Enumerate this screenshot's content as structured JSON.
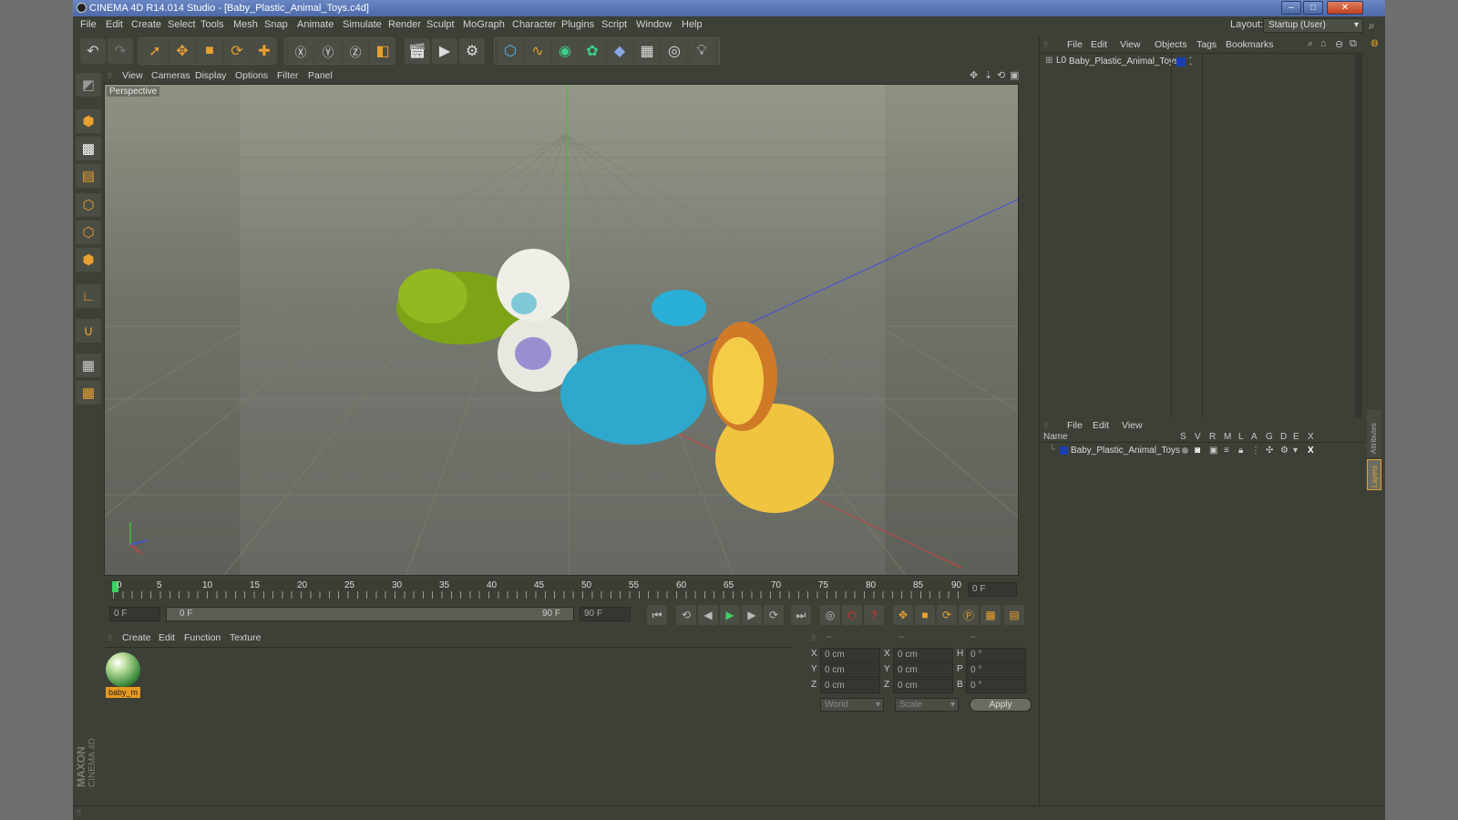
{
  "window": {
    "title": "CINEMA 4D R14.014 Studio - [Baby_Plastic_Animal_Toys.c4d]",
    "min": "–",
    "max": "□",
    "close": "✕"
  },
  "menu": [
    "File",
    "Edit",
    "Create",
    "Select",
    "Tools",
    "Mesh",
    "Snap",
    "Animate",
    "Simulate",
    "Render",
    "Sculpt",
    "MoGraph",
    "Character",
    "Plugins",
    "Script",
    "Window",
    "Help"
  ],
  "layout": {
    "label": "Layout:",
    "value": "Startup (User)"
  },
  "viewport": {
    "menu": [
      "View",
      "Cameras",
      "Display",
      "Options",
      "Filter",
      "Panel"
    ],
    "label": "Perspective"
  },
  "timeline": {
    "ticks": [
      "0",
      "5",
      "10",
      "15",
      "20",
      "25",
      "30",
      "35",
      "40",
      "45",
      "50",
      "55",
      "60",
      "65",
      "70",
      "75",
      "80",
      "85",
      "90"
    ],
    "current_frame": "0 F"
  },
  "transport": {
    "start_field": "0 F",
    "range_start": "0 F",
    "range_end": "90 F",
    "end_field": "90 F"
  },
  "material_manager": {
    "menu": [
      "Create",
      "Edit",
      "Function",
      "Texture"
    ],
    "materials": [
      {
        "label": "baby_m"
      }
    ]
  },
  "coordinates": {
    "header": [
      "--",
      "--",
      "--"
    ],
    "rows": [
      {
        "a": "X",
        "av": "0 cm",
        "b": "X",
        "bv": "0 cm",
        "c": "H",
        "cv": "0 °"
      },
      {
        "a": "Y",
        "av": "0 cm",
        "b": "Y",
        "bv": "0 cm",
        "c": "P",
        "cv": "0 °"
      },
      {
        "a": "Z",
        "av": "0 cm",
        "b": "Z",
        "bv": "0 cm",
        "c": "B",
        "cv": "0 °"
      }
    ],
    "mode1": "World",
    "mode2": "Scale",
    "apply": "Apply"
  },
  "object_manager": {
    "menu": [
      "File",
      "Edit",
      "View",
      "Objects",
      "Tags",
      "Bookmarks"
    ],
    "objects": [
      {
        "name": "Baby_Plastic_Animal_Toys"
      }
    ]
  },
  "layer_manager": {
    "menu": [
      "File",
      "Edit",
      "View"
    ],
    "columns": [
      "Name",
      "S",
      "V",
      "R",
      "M",
      "L",
      "A",
      "G",
      "D",
      "E",
      "X"
    ],
    "layers": [
      {
        "name": "Baby_Plastic_Animal_Toys"
      }
    ]
  },
  "right_tabs": [
    "Attributes",
    "Layers"
  ],
  "brand": {
    "line1": "MAXON",
    "line2": "CINEMA 4D"
  },
  "colors": {
    "accent": "#e8a030",
    "panel": "#3d4037",
    "layer_color": "#1a3fb0",
    "material_label_bg": "#e89a20"
  }
}
